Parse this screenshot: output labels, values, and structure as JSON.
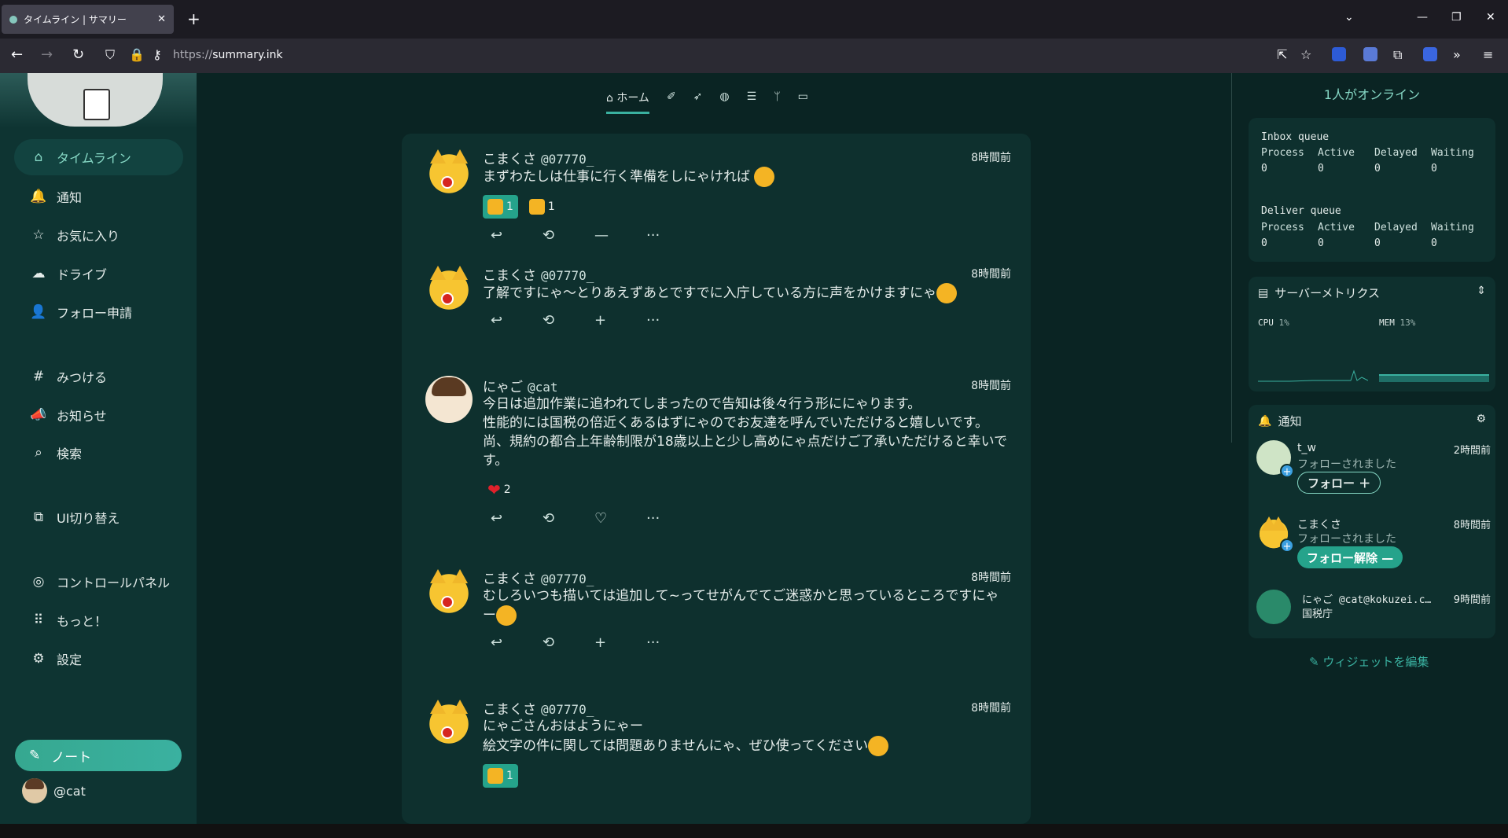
{
  "browser": {
    "tab_title": "タイムライン | サマリー",
    "tab_close": "✕",
    "new_tab": "+",
    "url_prefix": "https://",
    "url_host": "summary.ink"
  },
  "sidebar": {
    "items": [
      {
        "label": "タイムライン",
        "icon": "⌂"
      },
      {
        "label": "通知",
        "icon": "🔔"
      },
      {
        "label": "お気に入り",
        "icon": "☆"
      },
      {
        "label": "ドライブ",
        "icon": "☁"
      },
      {
        "label": "フォロー申請",
        "icon": "👤"
      },
      {
        "label": "みつける",
        "icon": "#"
      },
      {
        "label": "お知らせ",
        "icon": "📣"
      },
      {
        "label": "検索",
        "icon": "⌕"
      },
      {
        "label": "UI切り替え",
        "icon": "⧉"
      },
      {
        "label": "コントロールパネル",
        "icon": "◎"
      },
      {
        "label": "もっと！",
        "icon": "⠿"
      },
      {
        "label": "設定",
        "icon": "⚙"
      }
    ],
    "note_label": "ノート",
    "account": "@cat"
  },
  "main": {
    "home_tab": "ホーム",
    "posts": [
      {
        "name": "こまくさ",
        "user": "@07770_",
        "time": "8時間前",
        "text": "まずわたしは仕事に行く準備をしにゃければ",
        "reactions": [
          {
            "count": "1",
            "on": true
          },
          {
            "count": "1",
            "on": false
          }
        ],
        "third_action": "—"
      },
      {
        "name": "こまくさ",
        "user": "@07770_",
        "time": "8時間前",
        "text": "了解ですにゃ～とりあえずあとですでに入庁している方に声をかけますにゃ",
        "third_action": "+"
      },
      {
        "name": "にゃご",
        "user": "@cat",
        "time": "8時間前",
        "text": "今日は追加作業に追われてしまったので告知は後々行う形ににゃります。\n性能的には国税の倍近くあるはずにゃのでお友達を呼んでいただけると嬉しいです。尚、規約の都合上年齢制限が18歳以上と少し高めにゃ点だけご了承いただけると幸いです。",
        "heart_count": "2",
        "third_action": "♡"
      },
      {
        "name": "こまくさ",
        "user": "@07770_",
        "time": "8時間前",
        "text": "むしろいつも描いては追加して~ってせがんでてご迷惑かと思っているところですにゃー",
        "third_action": "+"
      },
      {
        "name": "こまくさ",
        "user": "@07770_",
        "time": "8時間前",
        "text": "にゃごさんおはようにゃー\n絵文字の件に関しては問題ありませんにゃ、ぜひ使ってください",
        "reaction_count": "1"
      }
    ]
  },
  "right": {
    "online": "1人がオンライン",
    "inbox_title": "Inbox queue",
    "deliver_title": "Deliver queue",
    "queue_headers": [
      "Process",
      "Active",
      "Delayed",
      "Waiting"
    ],
    "inbox_values": [
      "0",
      "0",
      "0",
      "0"
    ],
    "deliver_values": [
      "0",
      "0",
      "0",
      "0"
    ],
    "metrics_title": "サーバーメトリクス",
    "cpu_label": "CPU",
    "cpu_value": "1%",
    "mem_label": "MEM",
    "mem_value": "13%",
    "notif_title": "通知",
    "notifications": [
      {
        "name": "t_w",
        "time": "2時間前",
        "sub": "フォローされました",
        "button": "フォロー ＋"
      },
      {
        "name": "こまくさ",
        "time": "8時間前",
        "sub": "フォローされました",
        "button": "フォロー解除 —"
      },
      {
        "name": "にゃご @cat@kokuzei.c…",
        "time": "9時間前",
        "sub": "国税庁"
      }
    ],
    "edit_widgets": "ウィジェットを編集"
  },
  "colors": {
    "accent": "#3ab1a0",
    "background": "#0a2423",
    "panel": "#0e302e"
  }
}
